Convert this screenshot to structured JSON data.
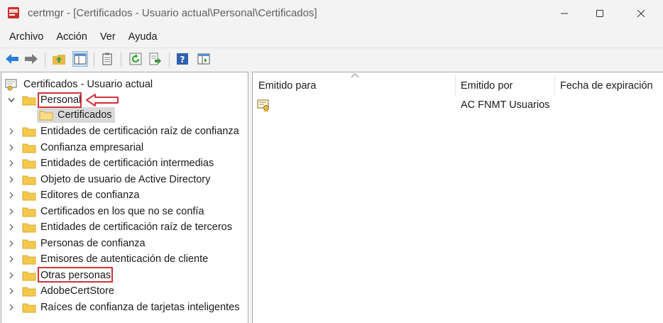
{
  "window": {
    "title": "certmgr - [Certificados - Usuario actual\\Personal\\Certificados]"
  },
  "menu": [
    "Archivo",
    "Acción",
    "Ver",
    "Ayuda"
  ],
  "toolbar": {
    "icons": [
      "back-arrow-icon",
      "forward-arrow-icon",
      "up-folder-icon",
      "show-hide-tree-icon",
      "clipboard-icon",
      "refresh-icon",
      "export-list-icon",
      "help-icon",
      "properties-icon"
    ]
  },
  "tree": {
    "root": "Certificados - Usuario actual",
    "personal": "Personal",
    "personal_child": "Certificados",
    "stores": [
      "Entidades de certificación raíz de confianza",
      "Confianza empresarial",
      "Entidades de certificación intermedias",
      "Objeto de usuario de Active Directory",
      "Editores de confianza",
      "Certificados en los que no se confía",
      "Entidades de certificación raíz de terceros",
      "Personas de confianza",
      "Emisores de autenticación de cliente",
      "Otras personas",
      "AdobeCertStore",
      "Raíces de confianza de tarjetas inteligentes"
    ]
  },
  "list": {
    "columns": [
      "Emitido para",
      "Emitido por",
      "Fecha de expiración"
    ],
    "rows": [
      {
        "issued_to": "",
        "issued_by": "AC FNMT Usuarios",
        "expiration": ""
      }
    ]
  },
  "colors": {
    "highlight": "#d0343a",
    "selection": "#d9d9d9",
    "folder": "#f2c94c"
  }
}
